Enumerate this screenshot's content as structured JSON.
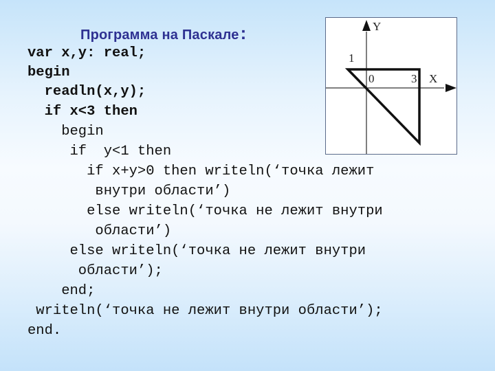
{
  "title": {
    "text": "Программа на Паскале",
    "colon": ":"
  },
  "code_lines": [
    "var x,y: real;",
    "begin",
    "  readln(x,y);",
    "  if x<3 then",
    "    begin",
    "     if  y<1 then",
    "       if x+y>0 then writeln(‘точка лежит",
    "        внутри области’)",
    "       else writeln(‘точка не лежит внутри",
    "        области’)",
    "     else writeln(‘точка не лежит внутри",
    "      области’);",
    "    end;",
    " writeln(‘точка не лежит внутри области’);",
    "end."
  ],
  "diagram": {
    "y_axis_label": "Y",
    "x_axis_label": "X",
    "tick_y": "1",
    "tick_origin": "0",
    "tick_x": "3",
    "region": "triangle bounded by y=1, x=3, x+y=0"
  },
  "colors": {
    "title": "#2e3192",
    "code": "#111111"
  }
}
